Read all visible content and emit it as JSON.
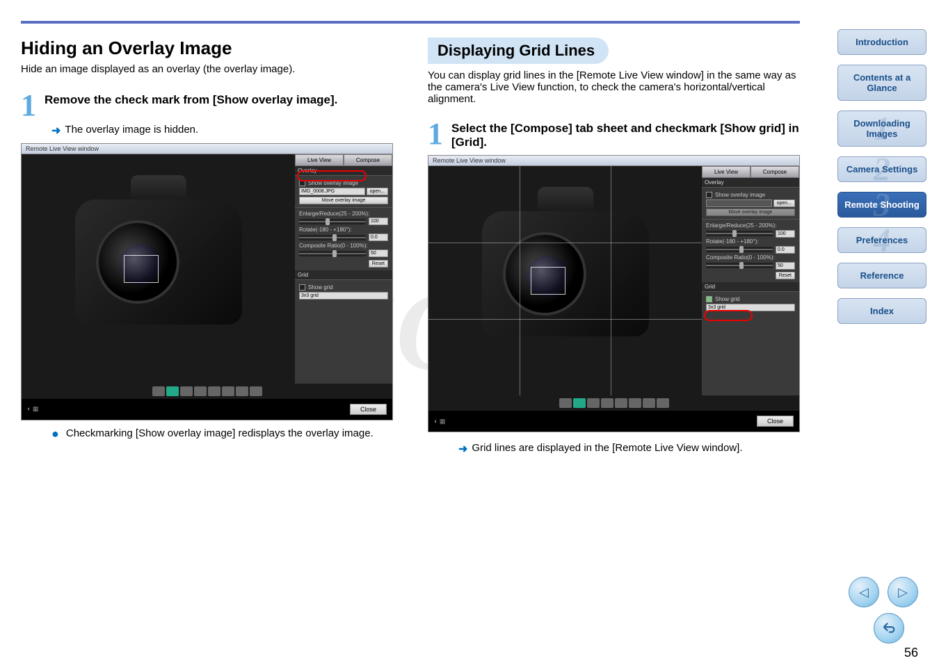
{
  "page_number": "56",
  "left": {
    "title": "Hiding an Overlay Image",
    "intro": "Hide an image displayed as an overlay (the overlay image).",
    "step1_num": "1",
    "step1_text": "Remove the check mark from [Show overlay image].",
    "arrow_text": "The overlay image is hidden.",
    "bullet_text": "Checkmarking [Show overlay image] redisplays the overlay image."
  },
  "right": {
    "section_tag": "Displaying Grid Lines",
    "intro": "You can display grid lines in the [Remote Live View window] in the same way as the camera's Live View function, to check the camera's horizontal/vertical alignment.",
    "step1_num": "1",
    "step1_text": "Select the [Compose] tab sheet and checkmark [Show grid] in [Grid].",
    "arrow_text": "Grid lines are displayed in the [Remote Live View window]."
  },
  "screenshot": {
    "window_title": "Remote Live View window",
    "tab_live": "Live View",
    "tab_compose": "Compose",
    "overlay_header": "Overlay",
    "show_overlay": "Show overlay image",
    "file_name": "IMG_0008.JPG",
    "open_btn": "open...",
    "move_btn": "Move overlay image",
    "enlarge_label": "Enlarge/Reduce(25 - 200%):",
    "enlarge_val": "100",
    "rotate_label": "Rotate(-180 - +180°):",
    "rotate_val": "0.0",
    "composite_label": "Composite Ratio(0 - 100%):",
    "composite_val": "50",
    "reset_btn": "Reset",
    "grid_header": "Grid",
    "show_grid": "Show grid",
    "grid_select": "3x3 grid",
    "close_btn": "Close"
  },
  "nav": {
    "intro": "Introduction",
    "contents": "Contents at a Glance",
    "download": "Downloading Images",
    "camera": "Camera Settings",
    "remote": "Remote Shooting",
    "prefs": "Preferences",
    "reference": "Reference",
    "index": "Index"
  },
  "watermark": "COPY"
}
